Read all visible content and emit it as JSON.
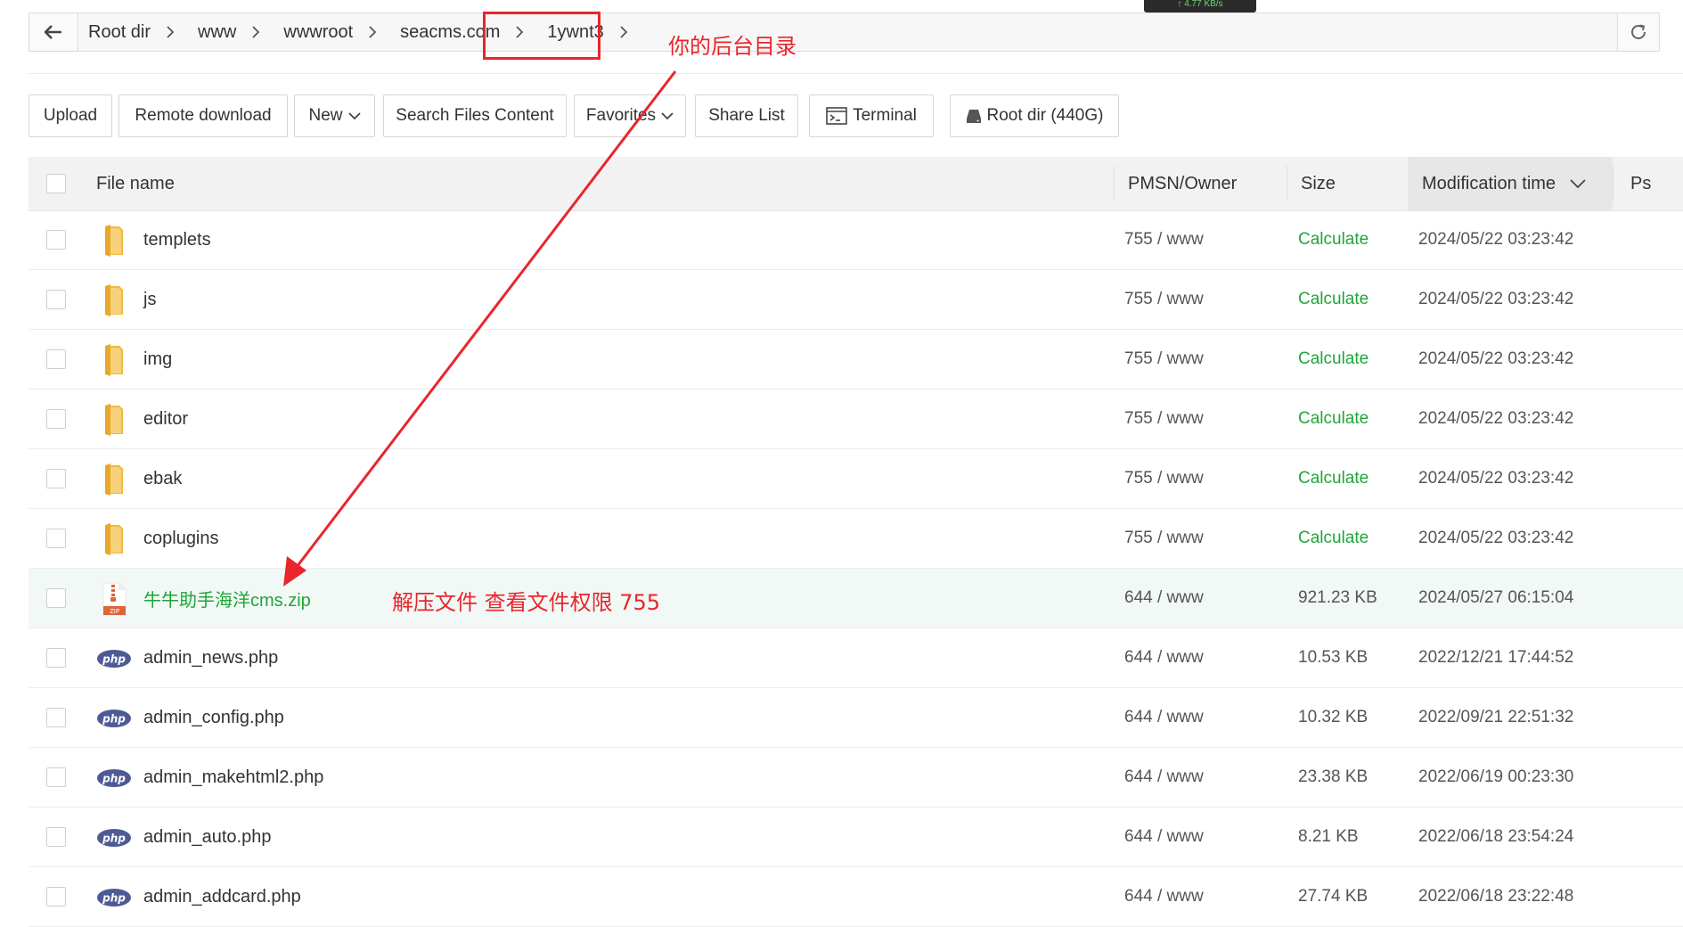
{
  "tooltip": "↑ 4.77 KB/s",
  "breadcrumb": [
    "Root dir",
    "www",
    "wwwroot",
    "seacms.com",
    "1ywnt3"
  ],
  "toolbar": {
    "upload": "Upload",
    "remote_download": "Remote download",
    "new": "New",
    "search_files_content": "Search Files Content",
    "favorites": "Favorites",
    "share_list": "Share List",
    "terminal": "Terminal",
    "root_dir": "Root dir (440G)"
  },
  "table": {
    "headers": {
      "name": "File name",
      "pmsn": "PMSN/Owner",
      "size": "Size",
      "mtime": "Modification time",
      "ps": "Ps"
    },
    "rows": [
      {
        "name": "templets",
        "type": "folder",
        "pmsn": "755 / www",
        "size": "Calculate",
        "mtime": "2024/05/22 03:23:42"
      },
      {
        "name": "js",
        "type": "folder",
        "pmsn": "755 / www",
        "size": "Calculate",
        "mtime": "2024/05/22 03:23:42"
      },
      {
        "name": "img",
        "type": "folder",
        "pmsn": "755 / www",
        "size": "Calculate",
        "mtime": "2024/05/22 03:23:42"
      },
      {
        "name": "editor",
        "type": "folder",
        "pmsn": "755 / www",
        "size": "Calculate",
        "mtime": "2024/05/22 03:23:42"
      },
      {
        "name": "ebak",
        "type": "folder",
        "pmsn": "755 / www",
        "size": "Calculate",
        "mtime": "2024/05/22 03:23:42"
      },
      {
        "name": "coplugins",
        "type": "folder",
        "pmsn": "755 / www",
        "size": "Calculate",
        "mtime": "2024/05/22 03:23:42"
      },
      {
        "name": "牛牛助手海洋cms.zip",
        "type": "zip",
        "pmsn": "644 / www",
        "size": "921.23 KB",
        "mtime": "2024/05/27 06:15:04"
      },
      {
        "name": "admin_news.php",
        "type": "php",
        "pmsn": "644 / www",
        "size": "10.53 KB",
        "mtime": "2022/12/21 17:44:52"
      },
      {
        "name": "admin_config.php",
        "type": "php",
        "pmsn": "644 / www",
        "size": "10.32 KB",
        "mtime": "2022/09/21 22:51:32"
      },
      {
        "name": "admin_makehtml2.php",
        "type": "php",
        "pmsn": "644 / www",
        "size": "23.38 KB",
        "mtime": "2022/06/19 00:23:30"
      },
      {
        "name": "admin_auto.php",
        "type": "php",
        "pmsn": "644 / www",
        "size": "8.21 KB",
        "mtime": "2022/06/18 23:54:24"
      },
      {
        "name": "admin_addcard.php",
        "type": "php",
        "pmsn": "644 / www",
        "size": "27.74 KB",
        "mtime": "2022/06/18 23:22:48"
      }
    ]
  },
  "annotations": {
    "backend_dir": "你的后台目录",
    "unzip_note": "解压文件 查看文件权限 755"
  },
  "icons": {
    "back": "arrow-left-icon",
    "refresh": "refresh-icon",
    "folder": "folder-icon",
    "zip": "zip-file-icon",
    "php": "php-file-icon",
    "terminal": "terminal-icon",
    "disk": "disk-icon"
  },
  "colors": {
    "accent_green": "#20a53a",
    "annotation_red": "#e8262c",
    "highlight_row": "#f1f8f5",
    "folder_yellow": "#f5c748"
  }
}
